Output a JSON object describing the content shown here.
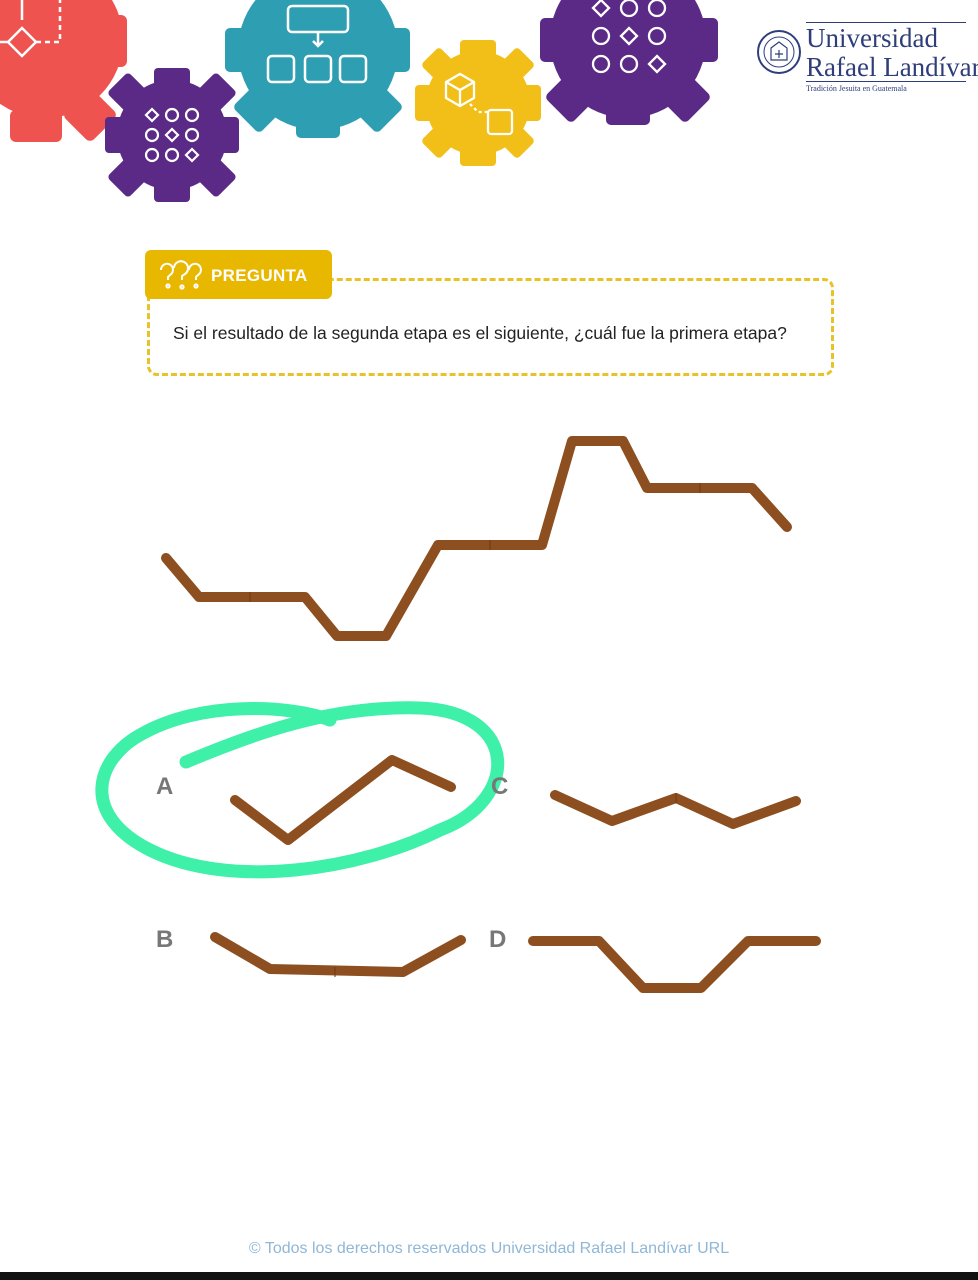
{
  "logo": {
    "name_line1": "Universidad",
    "name_line2": "Rafael Landívar",
    "motto": "Tradición Jesuita en Guatemala"
  },
  "question": {
    "tag_label": "PREGUNTA",
    "text": "Si el resultado de la segunda etapa es el siguiente, ¿cuál fue la primera etapa?"
  },
  "options": [
    {
      "letter": "A"
    },
    {
      "letter": "B"
    },
    {
      "letter": "C"
    },
    {
      "letter": "D"
    }
  ],
  "footer": {
    "copyright": "© Todos los derechos reservados Universidad Rafael Landívar URL"
  },
  "colors": {
    "gear_red": "#ef5350",
    "gear_purple": "#5b2a86",
    "gear_teal": "#2e9fb3",
    "gear_yellow": "#f2bf18",
    "stick": "#9c5a23",
    "highlight": "#3ef0a8"
  }
}
